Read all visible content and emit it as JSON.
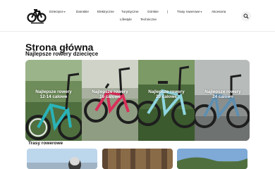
{
  "nav": {
    "items": [
      {
        "label": "Dziecięce",
        "caret": true
      },
      {
        "label": "Damskie",
        "caret": false
      },
      {
        "label": "Elektryczne",
        "caret": false
      },
      {
        "label": "Turystyczne",
        "caret": false
      },
      {
        "label": "Górskie",
        "caret": false
      },
      {
        "label": "|",
        "caret": false
      },
      {
        "label": "Trasy rowerowe",
        "caret": true
      },
      {
        "label": "Akcesoria",
        "caret": false
      },
      {
        "label": "Lifestyle",
        "caret": false
      },
      {
        "label": "Techniczne",
        "caret": false
      }
    ],
    "caret_symbol": "▾"
  },
  "page": {
    "title": "Strona główna",
    "section_title": "Najlepsze rowery dziecięce"
  },
  "cards": [
    {
      "label": "Najlepsze rowery 12-14 calowe",
      "frame_color": "#2ab3b8"
    },
    {
      "label": "Najlepsze rowery 16 calowe",
      "frame_color": "#d8305a"
    },
    {
      "label": "Najlepsze rowery 20 calowe",
      "frame_color": "#8fd6e0"
    },
    {
      "label": "Najlepsze rowery 24 calowe",
      "frame_color": "#5f8fb0"
    }
  ],
  "trails": {
    "title": "Trasy rowerowe"
  },
  "icons": {
    "logo": "bike-logo-icon",
    "search": "search-icon"
  }
}
